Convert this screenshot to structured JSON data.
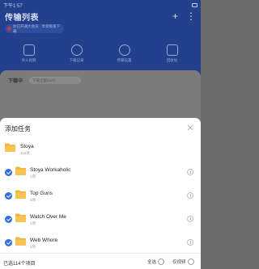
{
  "status_bar": {
    "time": "下午1:57"
  },
  "app": {
    "title": "传输列表",
    "info_pill": "你已开通大会员 · 享受极速下载",
    "quick_actions": [
      {
        "label": "导入视频",
        "icon": "import-icon"
      },
      {
        "label": "下载记录",
        "icon": "history-icon"
      },
      {
        "label": "传输设置",
        "icon": "settings-icon"
      },
      {
        "label": "回收站",
        "icon": "trash-icon"
      }
    ],
    "tab_label": "下载中",
    "tab_pill": "下载全部(115)"
  },
  "sheet": {
    "title": "添加任务",
    "close_icon": "close-icon",
    "folder_color": "#f2b53b",
    "check_color": "#2f6fe0",
    "items": [
      {
        "name": "Stoya",
        "sub": "114项",
        "checkbox": false
      },
      {
        "name": "Stoya Workaholic",
        "sub": "1项",
        "checkbox": true,
        "checked": true
      },
      {
        "name": "Top Guns",
        "sub": "3项",
        "checkbox": true,
        "checked": true
      },
      {
        "name": "Watch Over Me",
        "sub": "1项",
        "checkbox": true,
        "checked": true
      },
      {
        "name": "Web Whore",
        "sub": "1项",
        "checkbox": true,
        "checked": true
      }
    ],
    "footer": {
      "selected_text": "已选114个项目",
      "select_all": "全选",
      "folders_only": "仅视频"
    }
  }
}
